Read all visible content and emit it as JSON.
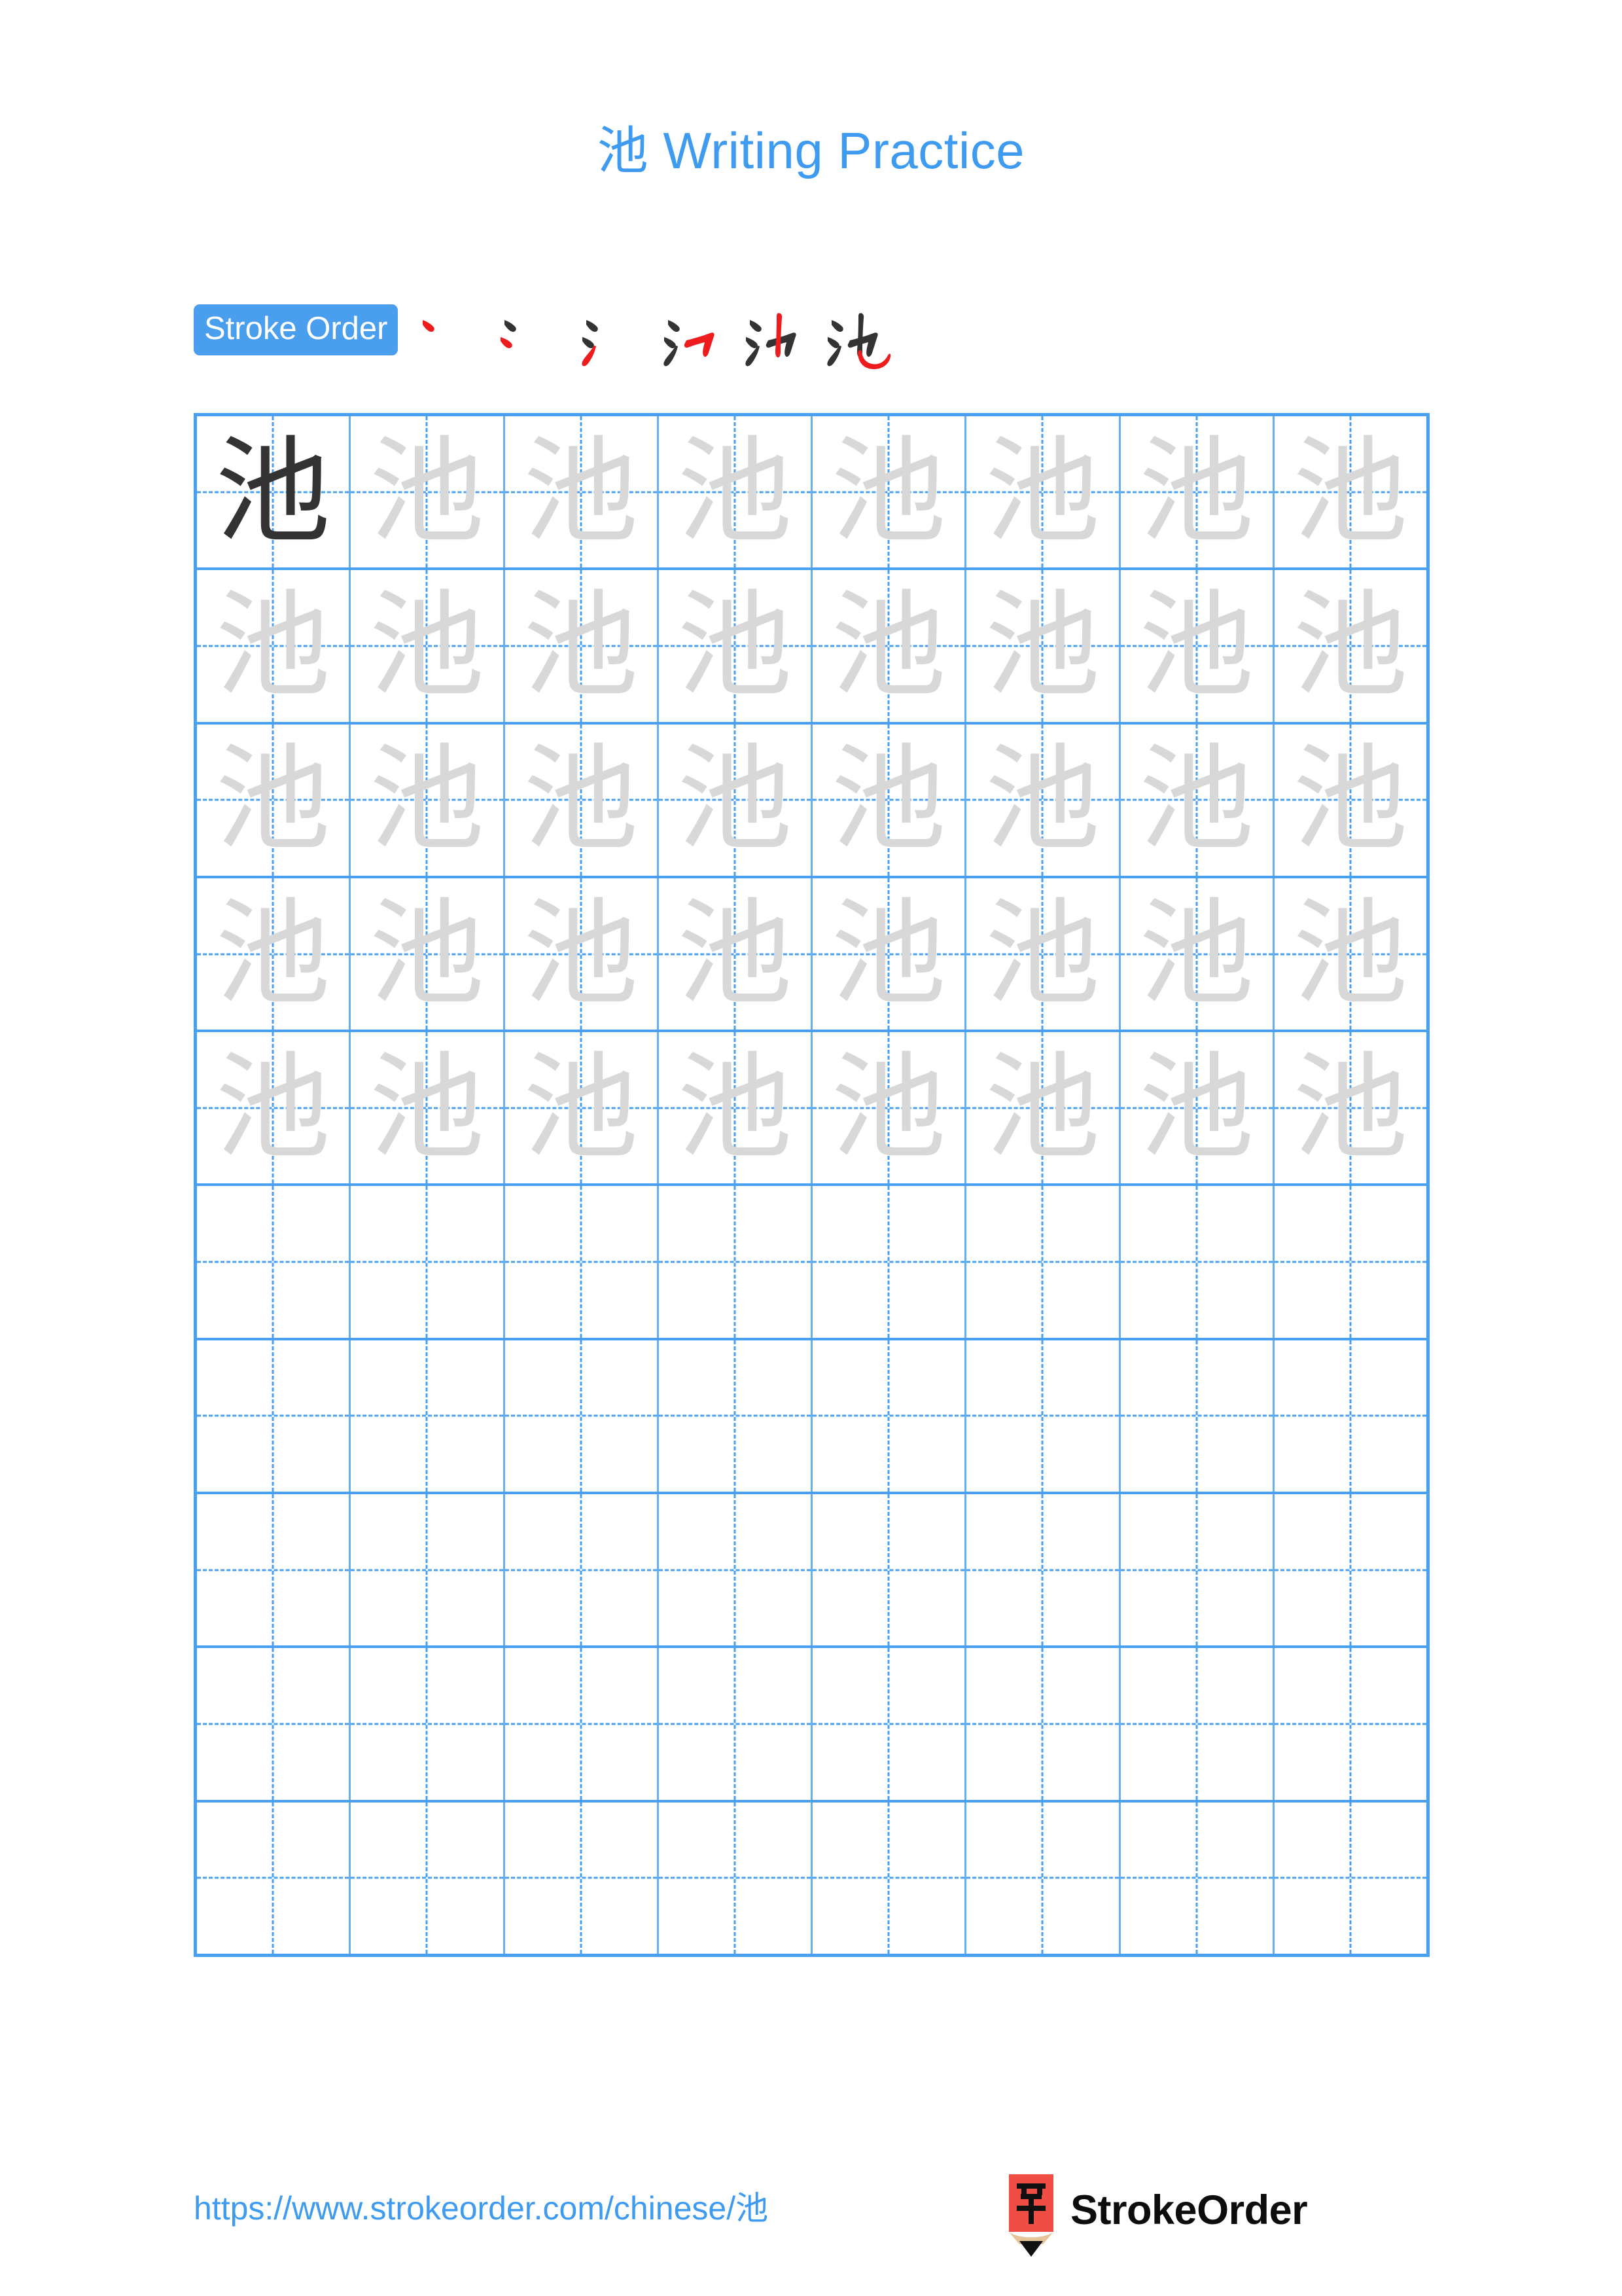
{
  "page": {
    "title_char": "池",
    "title_suffix": " Writing Practice",
    "background_color": "#ffffff"
  },
  "colors": {
    "accent_blue": "#3E9BF0",
    "badge_blue": "#4A9EEE",
    "grid_blue": "#4AA0F0",
    "grid_inner_blue": "#66B0F2",
    "stroke_new_red": "#EE1C1C",
    "stroke_done_black": "#333333",
    "trace_gray": "#D8D8D8",
    "logo_red": "#F04E45",
    "logo_tan": "#E5C49A"
  },
  "stroke_order": {
    "label": "Stroke Order",
    "character": "池",
    "total_strokes": 6,
    "steps": [
      {
        "step": 1,
        "strokes_shown": 1,
        "new_stroke_color": "#EE1C1C"
      },
      {
        "step": 2,
        "strokes_shown": 2,
        "new_stroke_color": "#EE1C1C"
      },
      {
        "step": 3,
        "strokes_shown": 3,
        "new_stroke_color": "#EE1C1C"
      },
      {
        "step": 4,
        "strokes_shown": 4,
        "new_stroke_color": "#EE1C1C"
      },
      {
        "step": 5,
        "strokes_shown": 5,
        "new_stroke_color": "#EE1C1C"
      },
      {
        "step": 6,
        "strokes_shown": 6,
        "new_stroke_color": "#EE1C1C"
      }
    ]
  },
  "practice_grid": {
    "character": "池",
    "columns": 8,
    "rows": 10,
    "rows_data": [
      {
        "cells": [
          "dark",
          "trace",
          "trace",
          "trace",
          "trace",
          "trace",
          "trace",
          "trace"
        ]
      },
      {
        "cells": [
          "trace",
          "trace",
          "trace",
          "trace",
          "trace",
          "trace",
          "trace",
          "trace"
        ]
      },
      {
        "cells": [
          "trace",
          "trace",
          "trace",
          "trace",
          "trace",
          "trace",
          "trace",
          "trace"
        ]
      },
      {
        "cells": [
          "trace",
          "trace",
          "trace",
          "trace",
          "trace",
          "trace",
          "trace",
          "trace"
        ]
      },
      {
        "cells": [
          "trace",
          "trace",
          "trace",
          "trace",
          "trace",
          "trace",
          "trace",
          "trace"
        ]
      },
      {
        "cells": [
          "empty",
          "empty",
          "empty",
          "empty",
          "empty",
          "empty",
          "empty",
          "empty"
        ]
      },
      {
        "cells": [
          "empty",
          "empty",
          "empty",
          "empty",
          "empty",
          "empty",
          "empty",
          "empty"
        ]
      },
      {
        "cells": [
          "empty",
          "empty",
          "empty",
          "empty",
          "empty",
          "empty",
          "empty",
          "empty"
        ]
      },
      {
        "cells": [
          "empty",
          "empty",
          "empty",
          "empty",
          "empty",
          "empty",
          "empty",
          "empty"
        ]
      },
      {
        "cells": [
          "empty",
          "empty",
          "empty",
          "empty",
          "empty",
          "empty",
          "empty",
          "empty"
        ]
      }
    ]
  },
  "footer": {
    "url": "https://www.strokeorder.com/chinese/池",
    "brand_name": "StrokeOrder",
    "logo_char": "字"
  }
}
